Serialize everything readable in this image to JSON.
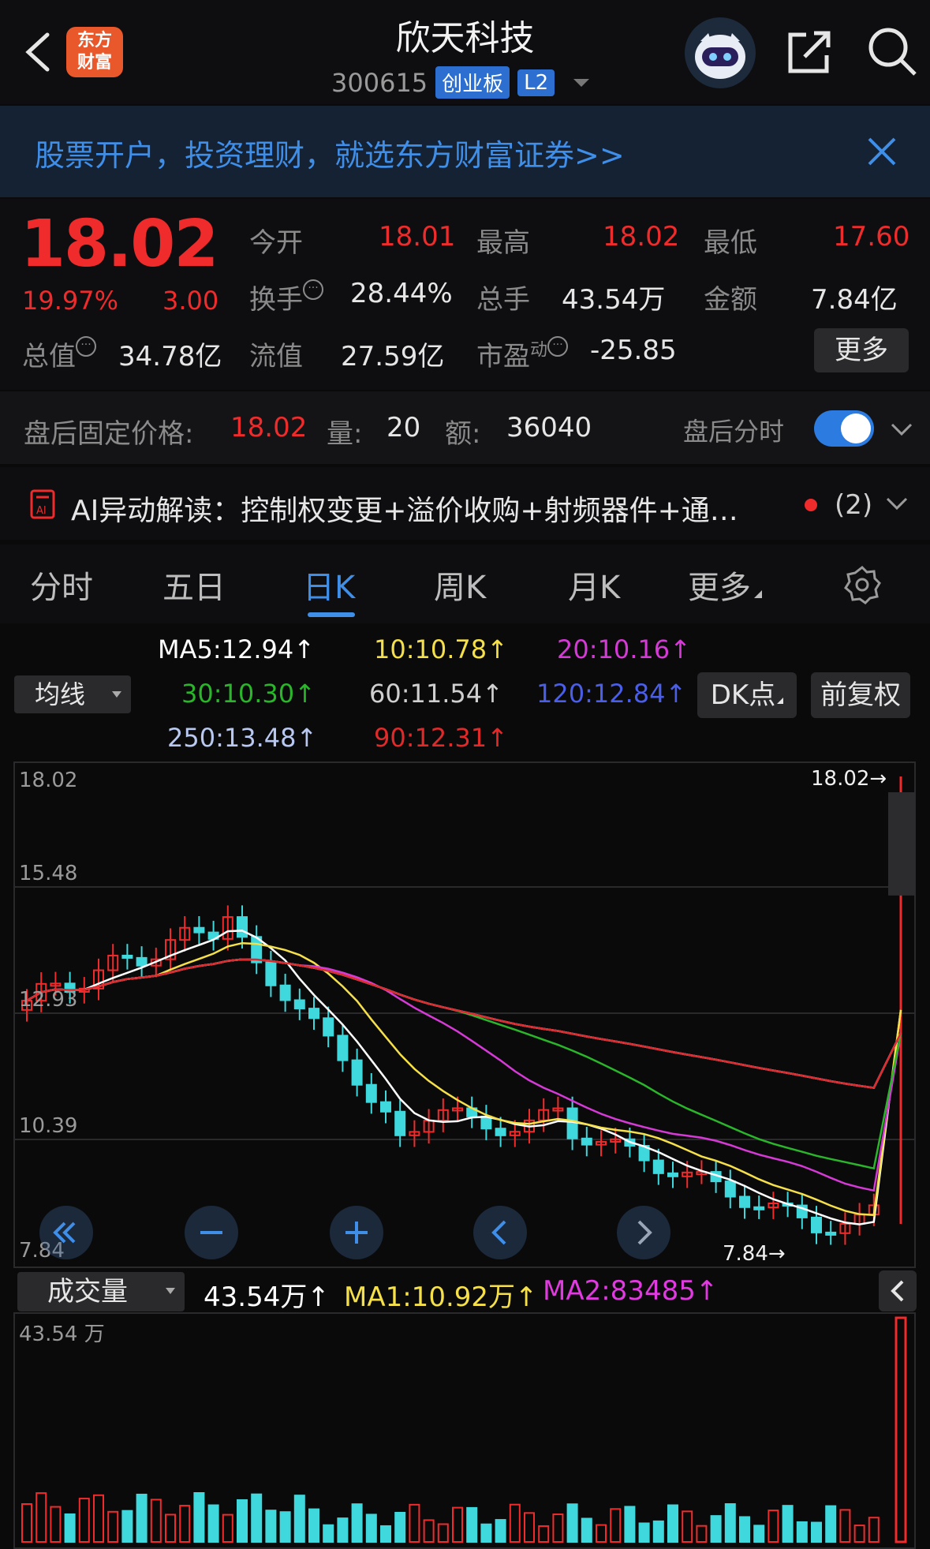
{
  "header": {
    "logo_line1": "东方",
    "logo_line2": "财富",
    "title": "欣天科技",
    "code": "300615",
    "board": "创业板",
    "level": "L2"
  },
  "banner": {
    "text": "股票开户，投资理财，就选东方财富证券>>"
  },
  "quote": {
    "price": "18.02",
    "change_pct": "19.97%",
    "change": "3.00",
    "open_label": "今开",
    "open": "18.01",
    "high_label": "最高",
    "high": "18.02",
    "low_label": "最低",
    "low": "17.60",
    "turnover_label": "换手",
    "turnover": "28.44%",
    "volume_label": "总手",
    "volume": "43.54万",
    "amount_label": "金额",
    "amount": "7.84亿",
    "mktcap_label": "总值",
    "mktcap": "34.78亿",
    "float_label": "流值",
    "float": "27.59亿",
    "pe_label": "市盈",
    "pe_sup": "动",
    "pe": "-25.85",
    "more_label": "更多"
  },
  "after_hours": {
    "label": "盘后固定价格:",
    "price": "18.02",
    "vol_label": "量:",
    "vol": "20",
    "amt_label": "额:",
    "amt": "36040",
    "toggle_label": "盘后分时",
    "toggle_on": true
  },
  "ai": {
    "text": "AI异动解读：控制权变更+溢价收购+射频器件+通…",
    "count": "(2)"
  },
  "tabs": [
    {
      "label": "分时"
    },
    {
      "label": "五日"
    },
    {
      "label": "日K",
      "active": true
    },
    {
      "label": "周K"
    },
    {
      "label": "月K"
    },
    {
      "label": "更多"
    }
  ],
  "ma": {
    "selector": "均线",
    "ma5": "MA5:12.94↑",
    "ma10": "10:10.78↑",
    "ma20": "20:10.16↑",
    "ma30": "30:10.30↑",
    "ma60": "60:11.54↑",
    "ma120": "120:12.84↑",
    "ma250": "250:13.48↑",
    "ma90": "90:12.31↑",
    "dk_label": "DK点",
    "adj_label": "前复权",
    "colors": {
      "ma5": "#ffffff",
      "ma10": "#f5e04a",
      "ma20": "#d63ad6",
      "ma30": "#2ab52a",
      "ma60": "#cfcfcf",
      "ma120": "#4a5ee8",
      "ma250": "#b8c8f0",
      "ma90": "#e02a2a"
    }
  },
  "chart_data": {
    "type": "candlestick",
    "y_ticks": [
      "18.02",
      "15.48",
      "12.93",
      "10.39",
      "7.84"
    ],
    "ylim": [
      7.84,
      18.02
    ],
    "high_marker": "18.02→",
    "low_marker": "7.84→",
    "up_color": "#ef2b2b",
    "down_color": "#3fd8dc"
  },
  "volume": {
    "selector": "成交量",
    "vol": "43.54万↑",
    "ma1": "MA1:10.92万↑",
    "ma2": "MA2:83485↑",
    "max_label": "43.54 万"
  }
}
